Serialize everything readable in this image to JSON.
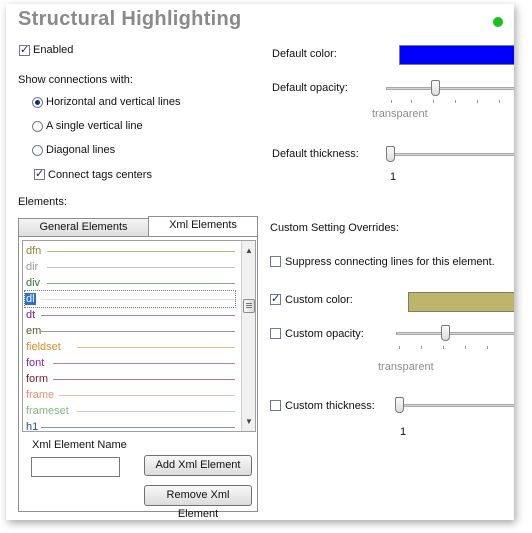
{
  "header": {
    "title": "Structural Highlighting",
    "status_color": "#18c21e"
  },
  "general": {
    "enabled_label": "Enabled",
    "enabled": true,
    "show_connections_label": "Show connections with:",
    "options": [
      {
        "label": "Horizontal and vertical lines",
        "selected": true
      },
      {
        "label": "A single vertical line",
        "selected": false
      },
      {
        "label": "Diagonal lines",
        "selected": false
      }
    ],
    "connect_centers_label": "Connect tags centers",
    "connect_centers": true,
    "elements_label": "Elements:"
  },
  "defaults": {
    "color_label": "Default color:",
    "color_value": "#0000ff",
    "opacity_label": "Default opacity:",
    "opacity_note": "transparent",
    "thickness_label": "Default thickness:",
    "thickness_value": "1"
  },
  "tabs": [
    {
      "label": "General Elements",
      "active": false
    },
    {
      "label": "Xml Elements",
      "active": true
    }
  ],
  "elements_list": [
    {
      "name": "dfn",
      "color": "#8b8b2e",
      "selected": false
    },
    {
      "name": "dir",
      "color": "#9a9a9a",
      "selected": false
    },
    {
      "name": "div",
      "color": "#2e7a2e",
      "selected": false
    },
    {
      "name": "dl",
      "color": "#ffffff",
      "selected": true
    },
    {
      "name": "dt",
      "color": "#7a2a7a",
      "selected": false
    },
    {
      "name": "em",
      "color": "#5a5a2e",
      "selected": false
    },
    {
      "name": "fieldset",
      "color": "#d8902a",
      "selected": false
    },
    {
      "name": "font",
      "color": "#8a2ab0",
      "selected": false
    },
    {
      "name": "form",
      "color": "#7a1e2e",
      "selected": false
    },
    {
      "name": "frame",
      "color": "#e89070",
      "selected": false
    },
    {
      "name": "frameset",
      "color": "#88b888",
      "selected": false
    },
    {
      "name": "h1",
      "color": "#2a4a9a",
      "selected": false
    }
  ],
  "xml_element": {
    "name_label": "Xml Element Name",
    "name_value": "",
    "add_button": "Add Xml Element",
    "remove_button": "Remove Xml Element"
  },
  "overrides": {
    "title": "Custom Setting Overrides:",
    "suppress_label": "Suppress connecting lines for this element.",
    "suppress": false,
    "custom_color_label": "Custom color:",
    "custom_color": true,
    "custom_color_value": "#bdb56a",
    "custom_opacity_label": "Custom opacity:",
    "custom_opacity": false,
    "opacity_note": "transparent",
    "custom_thickness_label": "Custom thickness:",
    "custom_thickness": false,
    "thickness_value": "1"
  }
}
